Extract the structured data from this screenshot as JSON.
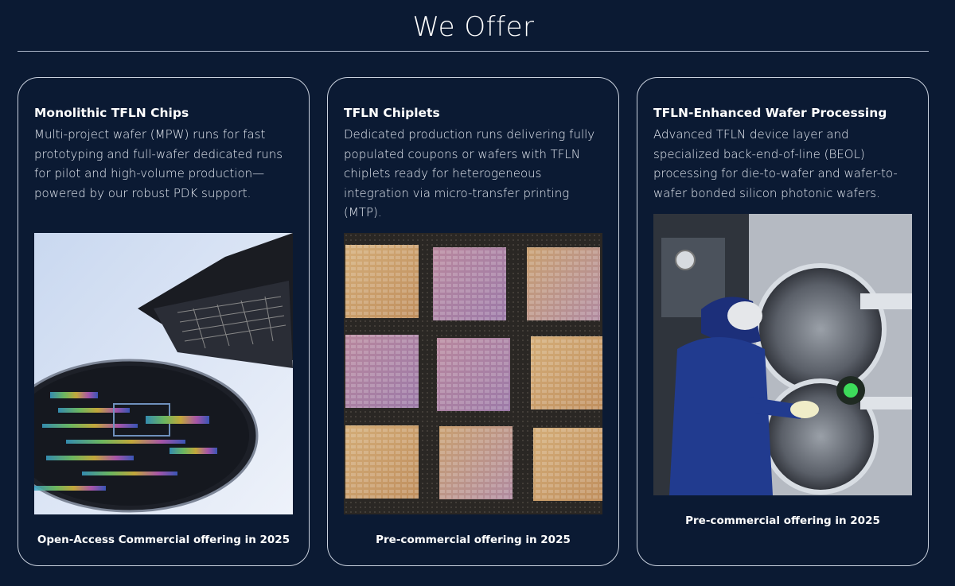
{
  "header": {
    "title": "We Offer"
  },
  "cards": [
    {
      "title": "Monolithic TFLN Chips",
      "body": "Multi-project wafer (MPW) runs for fast prototyping and full-wafer dedicated runs for pilot and high-volume production—powered by our robust PDK support.",
      "image_icon": "wafer-photo",
      "footer": "Open-Access Commercial offering in 2025"
    },
    {
      "title": "TFLN Chiplets",
      "body": "Dedicated production runs delivering fully populated coupons or wafers with TFLN chiplets ready for heterogeneous integration via micro-transfer printing (MTP).",
      "image_icon": "chiplets-photo",
      "footer": "Pre-commercial offering in 2025"
    },
    {
      "title": "TFLN-Enhanced Wafer Processing",
      "body": "Advanced TFLN device layer and specialized back-end-of-line (BEOL) processing for die-to-wafer and wafer-to-wafer bonded silicon photonic wafers.",
      "image_icon": "cleanroom-photo",
      "footer": "Pre-commercial offering in 2025"
    }
  ],
  "colors": {
    "background": "#0b1a33",
    "card_border": "#c9d1de",
    "text": "#ffffff"
  }
}
